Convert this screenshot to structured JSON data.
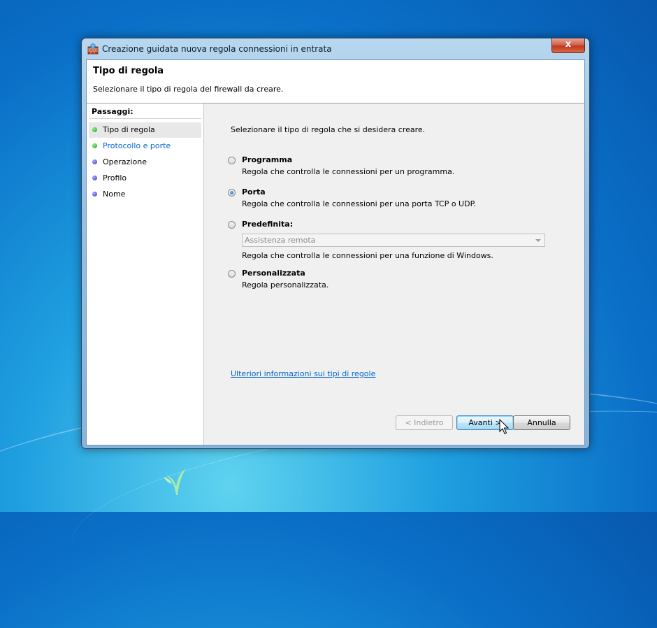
{
  "window": {
    "title": "Creazione guidata nuova regola connessioni in entrata",
    "close_label": "x"
  },
  "header": {
    "title": "Tipo di regola",
    "subtitle": "Selezionare il tipo di regola del firewall da creare."
  },
  "steps": {
    "title": "Passaggi:",
    "items": [
      {
        "label": "Tipo di regola",
        "state": "current",
        "dot_color": "#1aa51e"
      },
      {
        "label": "Protocollo e porte",
        "state": "link",
        "dot_color": "#1aa51e"
      },
      {
        "label": "Operazione",
        "state": "pending",
        "dot_color": "#3c3cba"
      },
      {
        "label": "Profilo",
        "state": "pending",
        "dot_color": "#3c3cba"
      },
      {
        "label": "Nome",
        "state": "pending",
        "dot_color": "#3c3cba"
      }
    ]
  },
  "content": {
    "intro": "Selezionare il tipo di regola che si desidera creare.",
    "options": [
      {
        "label": "Programma",
        "description": "Regola che controlla le connessioni per un programma.",
        "selected": false
      },
      {
        "label": "Porta",
        "description": "Regola che controlla le connessioni per una porta TCP o UDP.",
        "selected": true
      },
      {
        "label": "Predefinita:",
        "description": "Regola che controlla le connessioni per una funzione di Windows.",
        "selected": false
      },
      {
        "label": "Personalizzata",
        "description": "Regola personalizzata.",
        "selected": false
      }
    ],
    "predefined_select": {
      "value": "Assistenza remota",
      "disabled": true
    },
    "more_info_link": "Ulteriori informazioni sui tipi di regole"
  },
  "buttons": {
    "back": "< Indietro",
    "next": "Avanti >",
    "cancel": "Annulla"
  },
  "colors": {
    "link": "#0066cc",
    "step_done": "#1aa51e",
    "step_pending": "#3c3cba"
  }
}
